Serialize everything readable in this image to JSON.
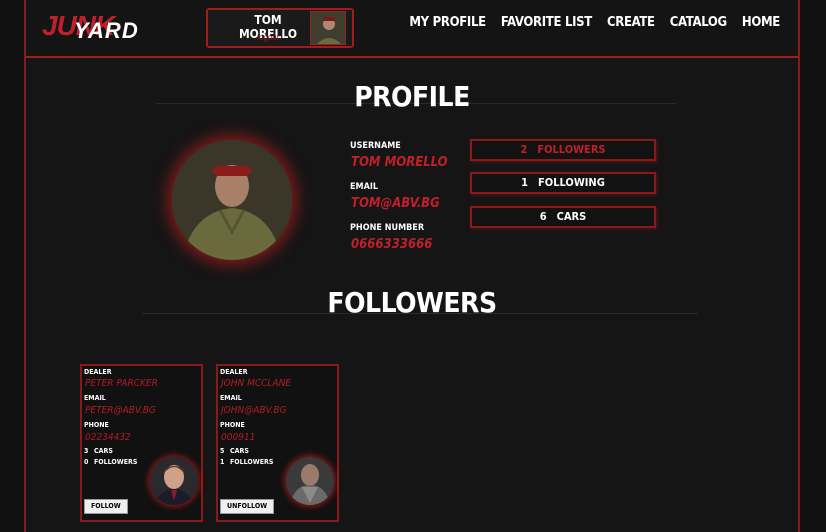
{
  "header": {
    "logo_part1": "JUNK",
    "logo_part2": "YARD",
    "user_name": "TOM MORELLO",
    "logout_label": "logout",
    "nav": [
      "MY PROFILE",
      "FAVORITE LIST",
      "CREATE",
      "CATALOG",
      "HOME"
    ]
  },
  "profile": {
    "title": "PROFILE",
    "username_label": "USERNAME",
    "username": "TOM MORELLO",
    "email_label": "EMAIL",
    "email": "TOM@ABV.BG",
    "phone_label": "PHONE NUMBER",
    "phone": "0666333666",
    "stats": [
      {
        "count": "2",
        "label": "FOLLOWERS"
      },
      {
        "count": "1",
        "label": "FOLLOWING"
      },
      {
        "count": "6",
        "label": "CARS"
      }
    ]
  },
  "followers": {
    "title": "FOLLOWERS",
    "cards": [
      {
        "role_label": "DEALER",
        "name": "PETER PARCKER",
        "email_label": "EMAIL",
        "email": "PETER@ABV.BG",
        "phone_label": "PHONE",
        "phone": "02234432",
        "cars": "3",
        "cars_label": "CARS",
        "followers": "0",
        "followers_label": "FOLLOWERS",
        "button": "FOLLOW"
      },
      {
        "role_label": "DEALER",
        "name": "JOHN MCCLANE",
        "email_label": "EMAIL",
        "email": "JOHN@ABV.BG",
        "phone_label": "PHONE",
        "phone": "000911",
        "cars": "5",
        "cars_label": "CARS",
        "followers": "1",
        "followers_label": "FOLLOWERS",
        "button": "UNFOLLOW"
      }
    ]
  },
  "colors": {
    "accent": "#c0202a",
    "border": "#8a1a1a",
    "background": "#151515"
  }
}
